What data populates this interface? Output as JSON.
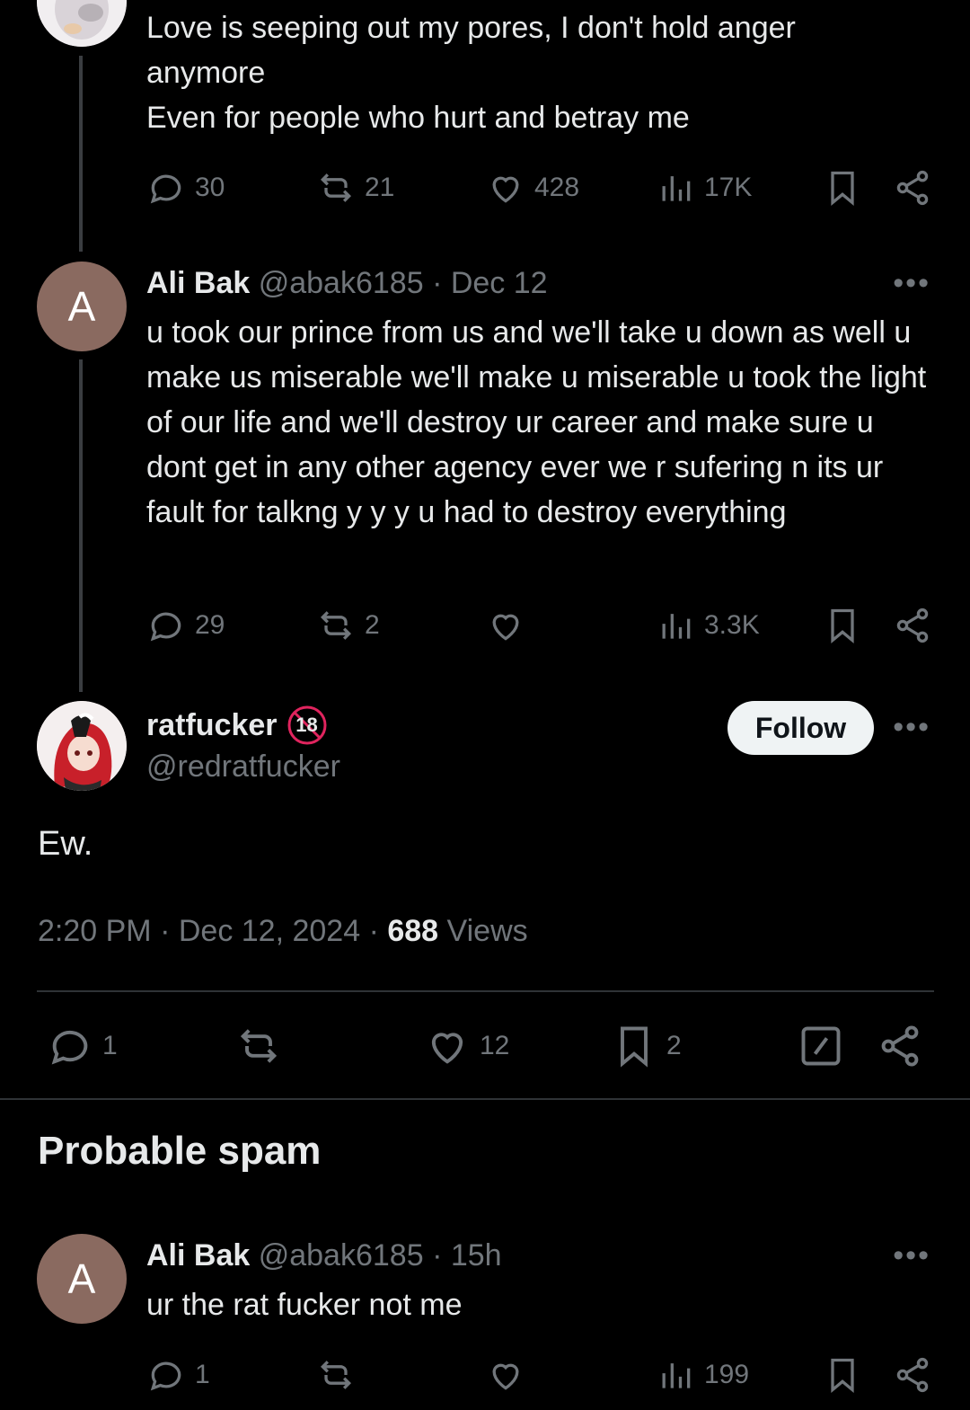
{
  "post1": {
    "text_lines": [
      "Love is seeping out my pores, I don't hold anger",
      "anymore",
      "Even for people who hurt and betray me"
    ],
    "replies": "30",
    "reposts": "21",
    "likes": "428",
    "views": "17K"
  },
  "post2": {
    "avatar_letter": "A",
    "name": "Ali Bak",
    "handle": "@abak6185",
    "sep": "·",
    "time": "Dec 12",
    "text": "u took our prince from us and we'll take u down as well u make us miserable we'll make u miserable u took the light of our life and we'll destroy ur career and make sure u dont get in any other agency ever we r sufering n its ur fault for talkng y y y u had to destroy everything",
    "replies": "29",
    "reposts": "2",
    "likes": "",
    "views": "3.3K"
  },
  "main_post": {
    "name": "ratfucker",
    "badge": "18",
    "handle": "@redratfucker",
    "follow_label": "Follow",
    "text": "Ew.",
    "time": "2:20 PM",
    "date": "Dec 12, 2024",
    "sep": "·",
    "views_count": "688",
    "views_label": "Views",
    "replies": "1",
    "reposts": "",
    "likes": "12",
    "bookmarks": "2"
  },
  "section": {
    "title": "Probable spam"
  },
  "post3": {
    "avatar_letter": "A",
    "name": "Ali Bak",
    "handle": "@abak6185",
    "sep": "·",
    "time": "15h",
    "text": "ur the rat fucker not me",
    "replies": "1",
    "reposts": "",
    "likes": "",
    "views": "199"
  },
  "more_glyph": "•••",
  "colors": {
    "background": "#000000",
    "text": "#e7e9ea",
    "muted": "#71767b",
    "divider": "#2f3336",
    "avatar": "#8a6a60"
  }
}
